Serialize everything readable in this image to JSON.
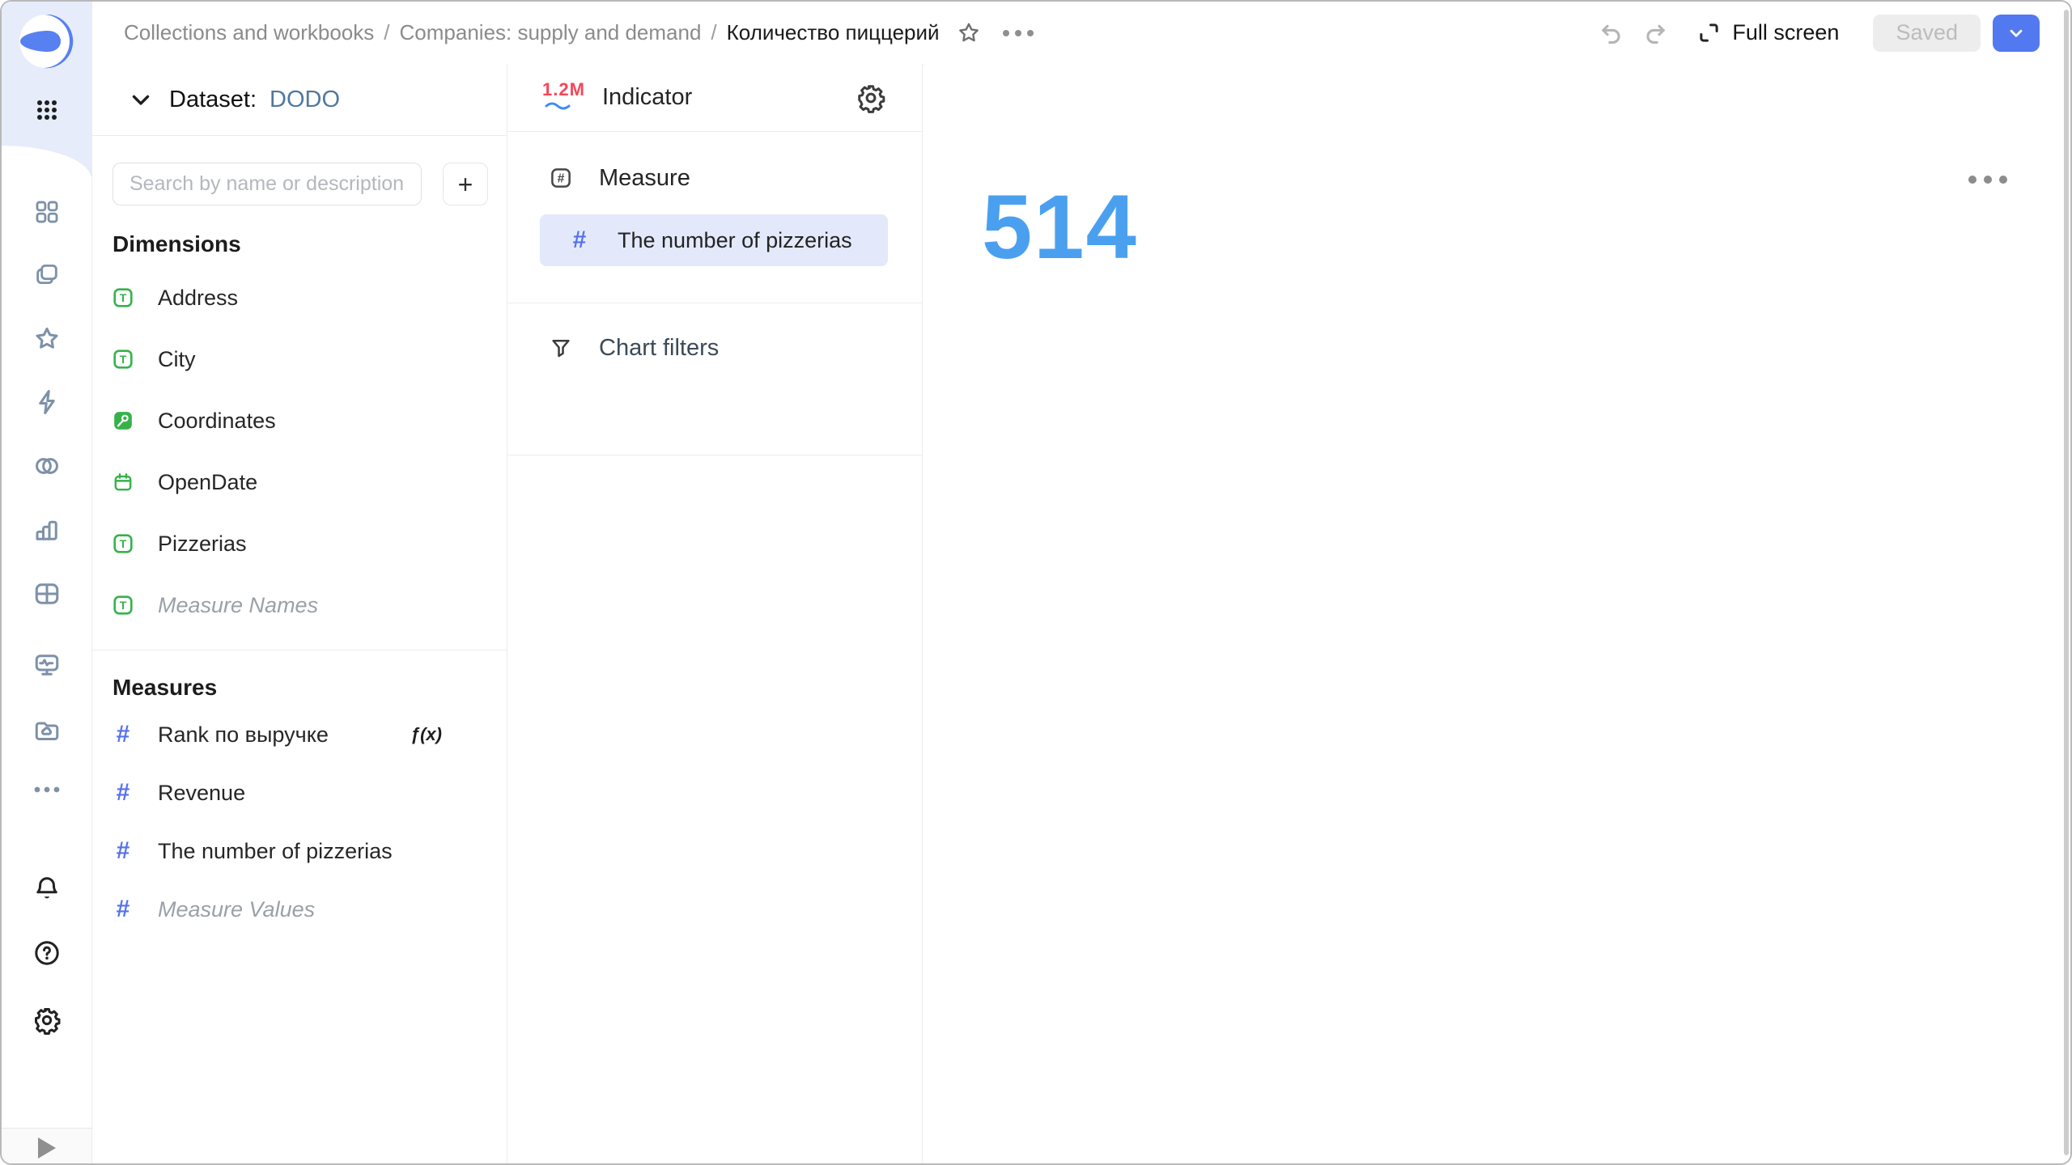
{
  "app": {
    "name": "DataLens"
  },
  "topbar": {
    "breadcrumbs": [
      "Collections and workbooks",
      "Companies: supply and demand",
      "Количество пиццерий"
    ],
    "breadcrumb_separator": "/",
    "full_screen_label": "Full screen",
    "saved_button_label": "Saved"
  },
  "rail": {
    "icons": [
      "datalens-logo",
      "apps-grid",
      "dashboards-grid",
      "collections",
      "favorites",
      "connections",
      "datasets",
      "charts",
      "tables",
      "monitoring",
      "storage",
      "more",
      "notifications",
      "help",
      "settings",
      "expand-sidebar"
    ]
  },
  "dataset_panel": {
    "dataset_label": "Dataset:",
    "dataset_name": "DODO",
    "search_placeholder": "Search by name or description",
    "add_button_label": "+",
    "dimensions": {
      "title": "Dimensions",
      "items": [
        {
          "name": "Address",
          "icon": "text-field-icon"
        },
        {
          "name": "City",
          "icon": "text-field-icon"
        },
        {
          "name": "Coordinates",
          "icon": "geo-field-icon"
        },
        {
          "name": "OpenDate",
          "icon": "date-field-icon"
        },
        {
          "name": "Pizzerias",
          "icon": "text-field-icon"
        },
        {
          "name": "Measure Names",
          "icon": "text-field-icon",
          "muted": true
        }
      ]
    },
    "measures": {
      "title": "Measures",
      "formula_badge": "ƒ(x)",
      "items": [
        {
          "name": "Rank по выручке",
          "icon": "number-field-icon",
          "formula": true
        },
        {
          "name": "Revenue",
          "icon": "number-field-icon"
        },
        {
          "name": "The number of pizzerias",
          "icon": "number-field-icon"
        },
        {
          "name": "Measure Values",
          "icon": "number-field-icon",
          "muted": true
        }
      ]
    }
  },
  "config_panel": {
    "chart_type_badge": "1.2M",
    "chart_type_label": "Indicator",
    "measure_section": {
      "title": "Measure",
      "selected_field": "The number of pizzerias"
    },
    "filters_section": {
      "title": "Chart filters"
    }
  },
  "canvas": {
    "indicator_value": "514"
  },
  "colors": {
    "accent_blue": "#5379f1",
    "measure_hash_blue": "#5671ee",
    "indicator_value_blue": "#4aa0ef",
    "field_green": "#36b24a",
    "badge_red": "#f5465a",
    "selected_row_bg": "#e3e9fa",
    "sidebar_top_bg": "#e7ecfb",
    "dataset_name_blue": "#50789e"
  }
}
